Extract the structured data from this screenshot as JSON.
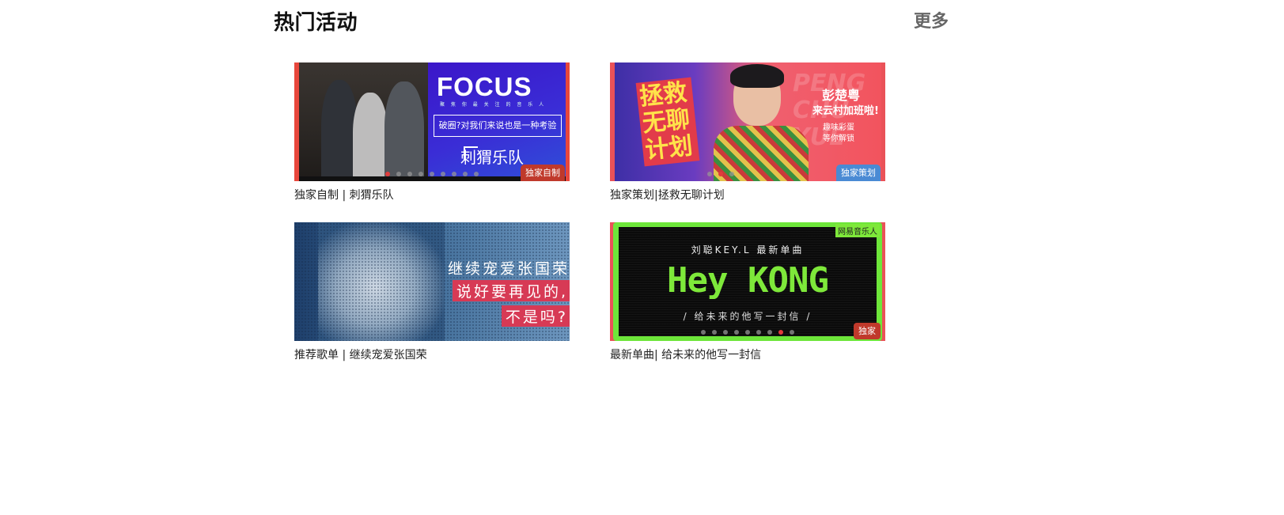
{
  "header": {
    "title": "热门活动",
    "more_label": "更多"
  },
  "cards": [
    {
      "caption": "独家自制 | 刺猬乐队",
      "tag": "独家自制",
      "banner": {
        "headline": "FOCUS",
        "sub": "聚 焦 你 最 关 注 的 音 乐 人",
        "quote": "破圈?对我们来说也是一种考验",
        "band": "刺猬乐队"
      }
    },
    {
      "caption": "独家策划|拯救无聊计划",
      "tag": "独家策划",
      "banner": {
        "title": "拯救无聊计划",
        "ghost": "PENG CHU YUE",
        "name": "彭楚粤",
        "line2": "来云村加班啦!",
        "line3a": "趣味彩蛋",
        "line3b": "等你解锁"
      }
    },
    {
      "caption": "推荐歌单 | 继续宠爱张国荣",
      "banner": {
        "line1": "继续宠爱张国荣",
        "line2": "说好要再见的,",
        "line3": "不是吗?"
      }
    },
    {
      "caption": "最新单曲| 给未来的他写一封信",
      "tag": "独家",
      "banner": {
        "artist": "刘聪KEY.L 最新单曲",
        "headline": "Hey KONG",
        "letter": "/ 给未来的他写一封信 /",
        "brand": "网易音乐人"
      }
    }
  ],
  "colors": {
    "accent_red": "#e8473c",
    "dot_active": "#e03c3c",
    "tag_red": "#c0392b",
    "tag_blue": "#4a8ad4"
  }
}
